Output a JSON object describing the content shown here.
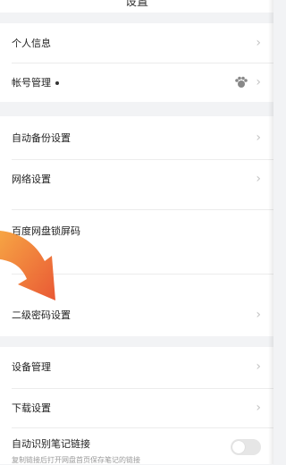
{
  "header": {
    "title": "设置"
  },
  "groups": [
    {
      "items": [
        {
          "label": "个人信息"
        },
        {
          "label": "帐号管理"
        }
      ]
    },
    {
      "items": [
        {
          "label": "自动备份设置"
        },
        {
          "label": "网络设置"
        },
        {
          "label": "百度网盘锁屏码"
        },
        {
          "label": "二级密码设置"
        }
      ]
    },
    {
      "items": [
        {
          "label": "设备管理"
        },
        {
          "label": "下载设置"
        },
        {
          "label": "自动识别笔记链接",
          "subtext": "复制链接后打开网盘首页保存笔记的链接"
        }
      ]
    }
  ],
  "icons": {
    "chevron": "chevron-right-icon",
    "account_avatar": "bear-paw-icon",
    "annotation": "orange-arrow-icon"
  },
  "toggle": {
    "state": "off"
  },
  "colors": {
    "background": "#f2f3f5",
    "surface": "#ffffff",
    "arrow": "#f0642a"
  }
}
